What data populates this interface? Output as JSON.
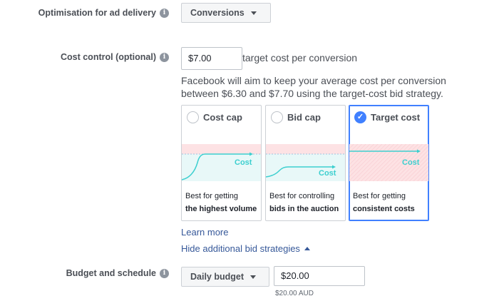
{
  "delivery": {
    "label": "Optimisation for ad delivery",
    "info_icon": "i",
    "select_value": "Conversions"
  },
  "cost_control": {
    "label": "Cost control (optional)",
    "info_icon": "i",
    "input_value": "$7.00",
    "suffix": "target cost per conversion",
    "description_line1": "Facebook will aim to keep your average cost per conversion",
    "description_line2": "between $6.30 and $7.70 using the target-cost bid strategy."
  },
  "strategies": [
    {
      "title": "Cost cap",
      "selected": false,
      "graph_label": "Cost",
      "desc1": "Best for getting",
      "desc2": "the highest volume"
    },
    {
      "title": "Bid cap",
      "selected": false,
      "graph_label": "Cost",
      "desc1": "Best for controlling",
      "desc2": "bids in the auction"
    },
    {
      "title": "Target cost",
      "selected": true,
      "graph_label": "Cost",
      "desc1": "Best for getting",
      "desc2": "consistent costs"
    }
  ],
  "links": {
    "learn_more": "Learn more",
    "hide_strategies": "Hide additional bid strategies"
  },
  "budget": {
    "label": "Budget and schedule",
    "info_icon": "i",
    "type_value": "Daily budget",
    "amount_value": "$20.00",
    "note": "$20.00 AUD"
  },
  "colors": {
    "accent_blue": "#4080ff",
    "graph_teal": "#3ccfcf",
    "graph_band_pink": "#fde2e4",
    "link_blue": "#365899"
  }
}
